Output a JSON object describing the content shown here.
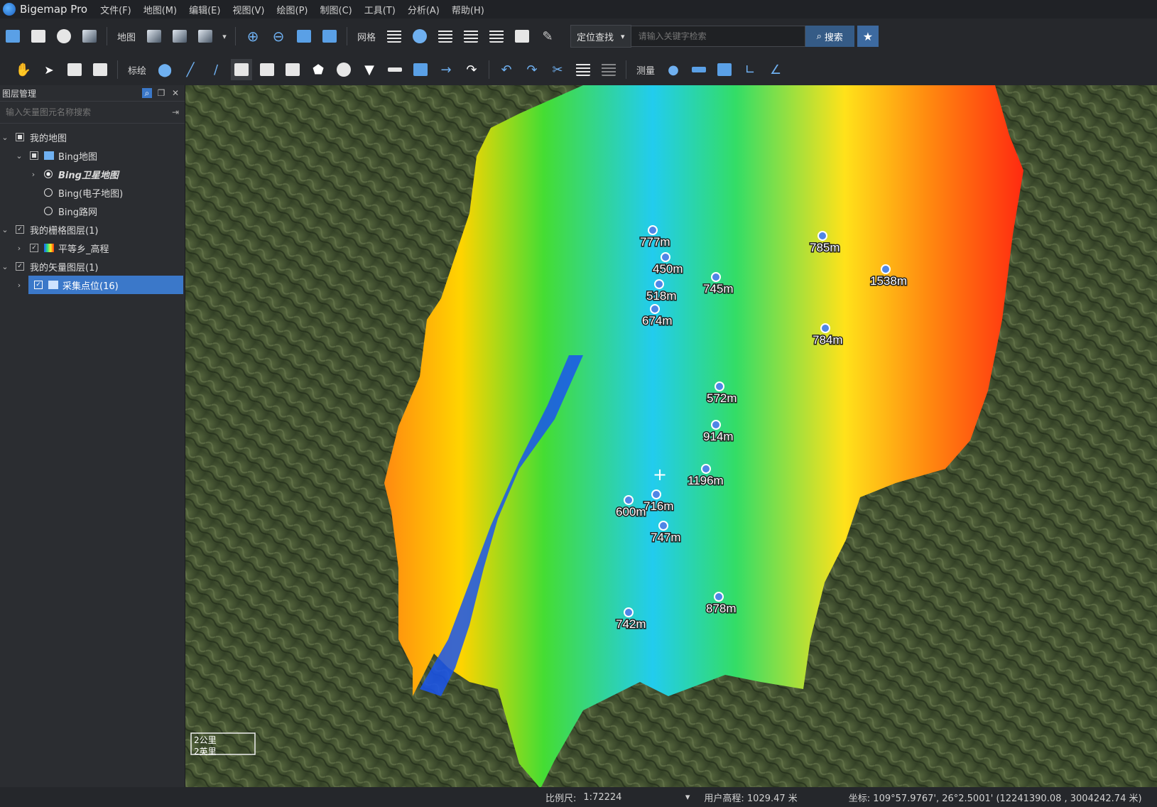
{
  "app": {
    "title": "Bigemap Pro"
  },
  "menu": [
    "文件(F)",
    "地图(M)",
    "编辑(E)",
    "视图(V)",
    "绘图(P)",
    "制图(C)",
    "工具(T)",
    "分析(A)",
    "帮助(H)"
  ],
  "toolbar1": {
    "map_label": "地图",
    "grid_label": "网格",
    "search_scope": "定位查找",
    "search_placeholder": "请输入关键字检索",
    "search_button": "搜索"
  },
  "toolbar2": {
    "annotate_label": "标绘",
    "measure_label": "测量"
  },
  "layer_panel": {
    "title": "图层管理",
    "search_placeholder": "输入矢量图元名称搜索",
    "tree": [
      {
        "label": "我的地图"
      },
      {
        "label": "Bing地图"
      },
      {
        "label": "Bing卫星地图"
      },
      {
        "label": "Bing(电子地图)"
      },
      {
        "label": "Bing路网"
      },
      {
        "label": "我的栅格图层(1)"
      },
      {
        "label": "平等乡_高程"
      },
      {
        "label": "我的矢量图层(1)"
      },
      {
        "label": "采集点位(16)"
      }
    ]
  },
  "map": {
    "markers": [
      {
        "label": "777m"
      },
      {
        "label": "450m"
      },
      {
        "label": "518m"
      },
      {
        "label": "674m"
      },
      {
        "label": "745m"
      },
      {
        "label": "785m"
      },
      {
        "label": "1538m"
      },
      {
        "label": "784m"
      },
      {
        "label": "572m"
      },
      {
        "label": "914m"
      },
      {
        "label": "1196m"
      },
      {
        "label": "716m"
      },
      {
        "label": "600m"
      },
      {
        "label": "747m"
      },
      {
        "label": "878m"
      },
      {
        "label": "742m"
      }
    ],
    "scale_km": "2公里",
    "scale_mi": "2英里"
  },
  "status": {
    "scale_label": "比例尺:",
    "scale_value": "1:72224",
    "elevation": "用户高程: 1029.47 米",
    "coords": "坐标: 109°57.9767', 26°2.5001' (12241390.08 , 3004242.74 米)"
  }
}
